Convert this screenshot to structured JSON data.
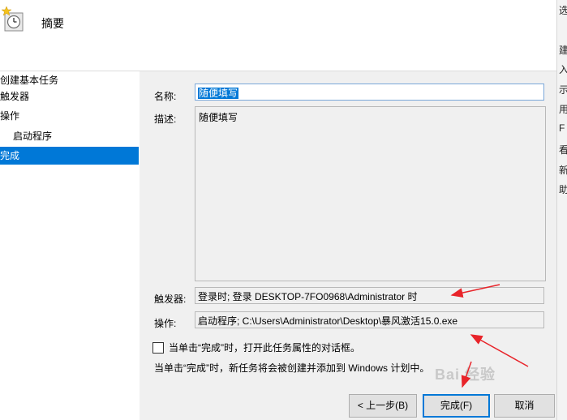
{
  "header": {
    "title": "摘要"
  },
  "nav": {
    "items": [
      {
        "label": "创建基本任务"
      },
      {
        "label": "触发器"
      },
      {
        "label": "操作"
      },
      {
        "label": "启动程序"
      },
      {
        "label": "完成"
      }
    ]
  },
  "form": {
    "name_label": "名称:",
    "name_value": "随便填写",
    "desc_label": "描述:",
    "desc_value": "随便填写",
    "trigger_label": "触发器:",
    "trigger_value": "登录时; 登录 DESKTOP-7FO0968\\Administrator 时",
    "action_label": "操作:",
    "action_value": "启动程序; C:\\Users\\Administrator\\Desktop\\暴风激活15.0.exe"
  },
  "checkbox": {
    "label": "当单击“完成”时，打开此任务属性的对话框。"
  },
  "info": {
    "text": "当单击“完成”时，新任务将会被创建并添加到 Windows 计划中。"
  },
  "buttons": {
    "back": "< 上一步(B)",
    "finish": "完成(F)",
    "cancel": "取消"
  },
  "right_strip": {
    "chars": [
      "选",
      "建",
      "入",
      "示",
      "用",
      "F",
      "看",
      "新",
      "助"
    ]
  },
  "watermark": "Bai 经验",
  "colors": {
    "accent": "#0078d7",
    "annotation_arrow": "#e8242a"
  }
}
